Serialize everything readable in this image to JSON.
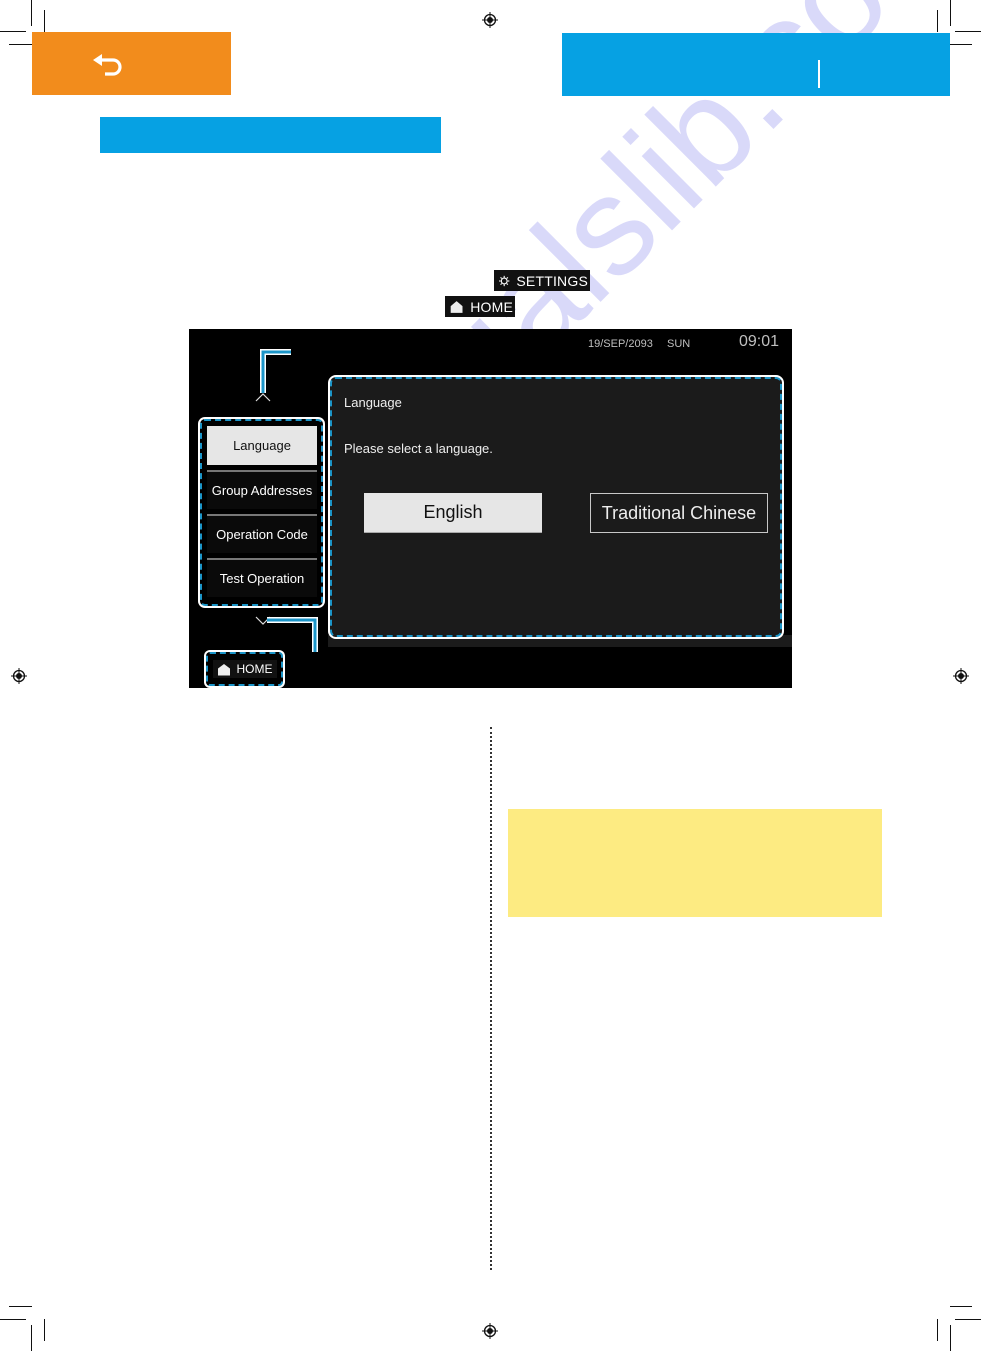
{
  "page": {
    "back_icon": "return-arrow-icon",
    "watermark": "manualslib.com"
  },
  "instructions": {
    "settings_chip": {
      "icon": "gear-icon",
      "label": "SETTINGS"
    },
    "home_chip": {
      "icon": "home-icon",
      "label": "HOME"
    }
  },
  "device_screen": {
    "date": "19/SEP/2093",
    "day": "SUN",
    "time": "09:01",
    "menu": {
      "items": [
        {
          "label": "Language",
          "active": true
        },
        {
          "label": "Group Addresses",
          "active": false
        },
        {
          "label": "Operation Code",
          "active": false
        },
        {
          "label": "Test Operation",
          "active": false
        }
      ]
    },
    "panel": {
      "title": "Language",
      "prompt": "Please select a language.",
      "options": [
        {
          "label": "English",
          "selected": true
        },
        {
          "label": "Traditional Chinese",
          "selected": false
        }
      ]
    },
    "home_button": {
      "icon": "home-icon",
      "label": "HOME"
    }
  },
  "colors": {
    "orange_tab": "#f28c1c",
    "blue_header": "#06a1e3",
    "callout_blue": "#1b95c8",
    "note_yellow": "#fdeb82"
  }
}
